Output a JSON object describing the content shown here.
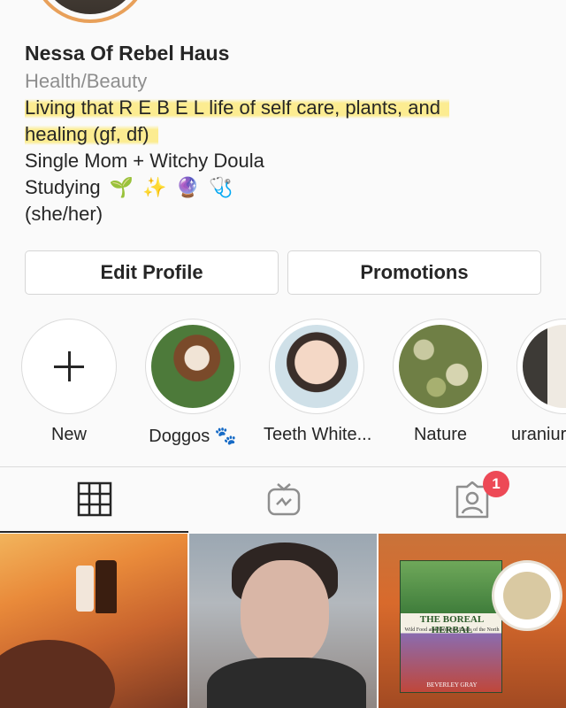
{
  "profile": {
    "name": "Nessa Of Rebel Haus",
    "category": "Health/Beauty",
    "bio_line_1": "Living that R E B E L life of self care, plants, and",
    "bio_line_2": "healing (gf, df)",
    "bio_line_3": "Single Mom + Witchy Doula",
    "bio_line_4": "Studying",
    "bio_emojis": [
      "🌱",
      "✨",
      "🔮",
      "🩺"
    ],
    "bio_line_5": "(she/her)"
  },
  "buttons": {
    "edit_profile": "Edit Profile",
    "promotions": "Promotions"
  },
  "highlights": [
    {
      "label": "New",
      "icon": "plus-icon"
    },
    {
      "label": "Doggos 🐾",
      "color": "#4d7a3a"
    },
    {
      "label": "Teeth White...",
      "color": "#cfe0e8"
    },
    {
      "label": "Nature",
      "color": "#6f7f45"
    },
    {
      "label": "uraniur",
      "color": "#3d3a36"
    }
  ],
  "tabs": [
    {
      "name": "grid",
      "icon": "grid-icon",
      "active": true
    },
    {
      "name": "igtv",
      "icon": "igtv-icon",
      "active": false
    },
    {
      "name": "tagged",
      "icon": "tagged-person-icon",
      "active": false
    }
  ],
  "notifications": {
    "tagged_badge": "1"
  },
  "posts": {
    "book_title": "THE BOREAL HERBAL",
    "book_subtitle": "Wild Food and Medicine Plants of the North",
    "book_author": "BEVERLEY GRAY"
  },
  "colors": {
    "highlight_marker": "#fce86e",
    "badge_red": "#ed4956",
    "avatar_ring": "#e8a05a"
  }
}
